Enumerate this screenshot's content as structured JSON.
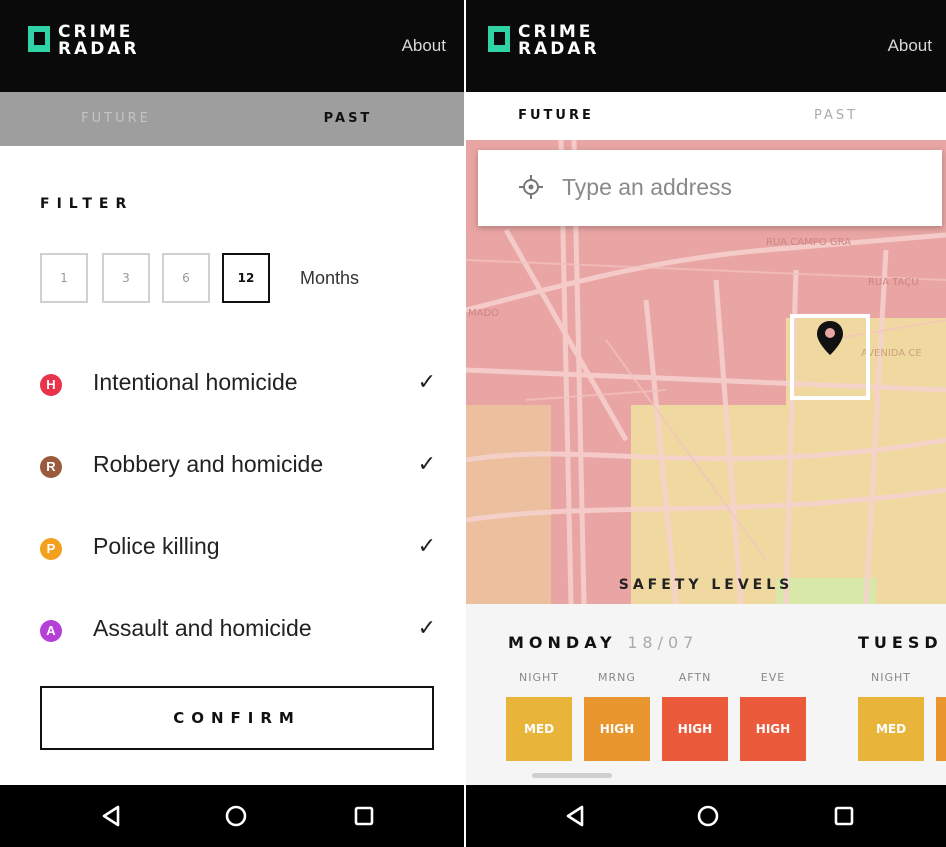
{
  "app": {
    "logo_line1": "CRIME",
    "logo_line2": "RADAR",
    "about_label": "About",
    "accent": "#2fd3a6"
  },
  "left": {
    "tabs": [
      {
        "label": "FUTURE",
        "active": false
      },
      {
        "label": "PAST",
        "active": true
      }
    ],
    "filter_title": "FILTER",
    "months": {
      "options": [
        "1",
        "3",
        "6",
        "12"
      ],
      "selected": "12",
      "unit_label": "Months"
    },
    "crimes": [
      {
        "badge": "H",
        "label": "Intentional homicide",
        "color": "#e8334a",
        "checked": true
      },
      {
        "badge": "R",
        "label": "Robbery and homicide",
        "color": "#9a5b3c",
        "checked": true
      },
      {
        "badge": "P",
        "label": "Police killing",
        "color": "#f2a01e",
        "checked": true
      },
      {
        "badge": "A",
        "label": "Assault and homicide",
        "color": "#b440d8",
        "checked": true
      }
    ],
    "check_glyph": "✓",
    "confirm_label": "CONFIRM"
  },
  "right": {
    "tabs": [
      {
        "label": "FUTURE",
        "active": true
      },
      {
        "label": "PAST",
        "active": false
      }
    ],
    "search": {
      "placeholder": "Type an address"
    },
    "map": {
      "street_labels": [
        "RUA CAMPO GRA",
        "RUA TAÇU",
        "AVENIDA CE",
        "MADO"
      ],
      "safety_levels_label": "SAFETY LEVELS",
      "level_colors": {
        "high": "#e9a5a3",
        "medium": "#f0d9a0",
        "low": "#d7e8a8"
      }
    },
    "days": [
      {
        "name": "MONDAY",
        "date": "18/07",
        "slots": [
          {
            "label": "NIGHT",
            "level": "MED",
            "color": "#e8b43a"
          },
          {
            "label": "MRNG",
            "level": "HIGH",
            "color": "#e9962e"
          },
          {
            "label": "AFTN",
            "level": "HIGH",
            "color": "#ec5a3c"
          },
          {
            "label": "EVE",
            "level": "HIGH",
            "color": "#ec5a3c"
          }
        ]
      },
      {
        "name": "TUESD",
        "date": "",
        "slots": [
          {
            "label": "NIGHT",
            "level": "MED",
            "color": "#e8b43a"
          }
        ]
      }
    ]
  },
  "nav": {
    "back_icon": "back-triangle-icon",
    "home_icon": "home-circle-icon",
    "recents_icon": "recents-square-icon"
  }
}
